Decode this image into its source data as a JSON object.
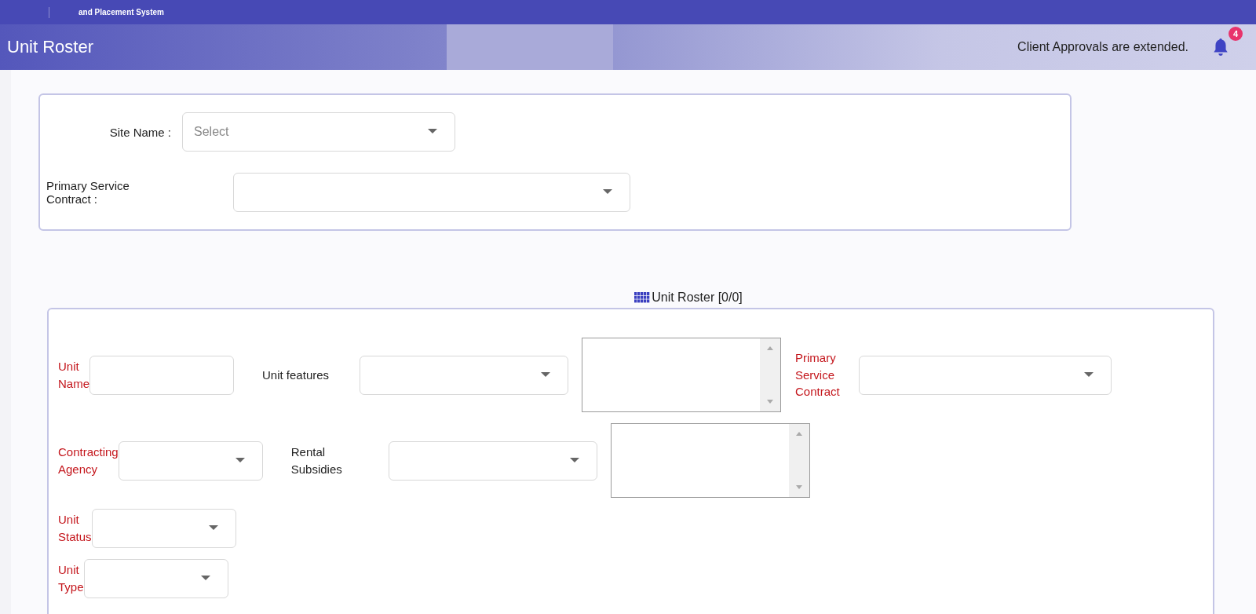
{
  "top_bar": {
    "subtitle": "and Placement System"
  },
  "header": {
    "title": "Unit Roster",
    "message": "Client Approvals are extended.",
    "notification_count": "4"
  },
  "filters": [
    {
      "label": "Site Name :",
      "placeholder": "Select",
      "kind": "short"
    },
    {
      "label": "Primary Service Contract :",
      "kind": "long"
    }
  ],
  "roster": {
    "title": "Unit Roster [0/0]",
    "rows": [
      [
        {
          "kind": "label",
          "text": "Unit Name",
          "required": true
        },
        {
          "kind": "input"
        },
        {
          "kind": "label",
          "text": "Unit features",
          "required": false
        },
        {
          "kind": "select"
        },
        {
          "kind": "textarea"
        },
        {
          "kind": "label",
          "text": "Primary Service Contract",
          "required": true
        },
        {
          "kind": "select"
        }
      ],
      [
        {
          "kind": "label",
          "text": "Contracting Agency",
          "required": true
        },
        {
          "kind": "select"
        },
        {
          "kind": "label",
          "text": "Rental Subsidies",
          "required": false
        },
        {
          "kind": "select"
        },
        {
          "kind": "textarea"
        }
      ],
      [
        {
          "kind": "label",
          "text": "Unit Status",
          "required": true
        },
        {
          "kind": "select"
        }
      ],
      [
        {
          "kind": "label",
          "text": "Unit Type",
          "required": true
        },
        {
          "kind": "select"
        }
      ]
    ]
  }
}
